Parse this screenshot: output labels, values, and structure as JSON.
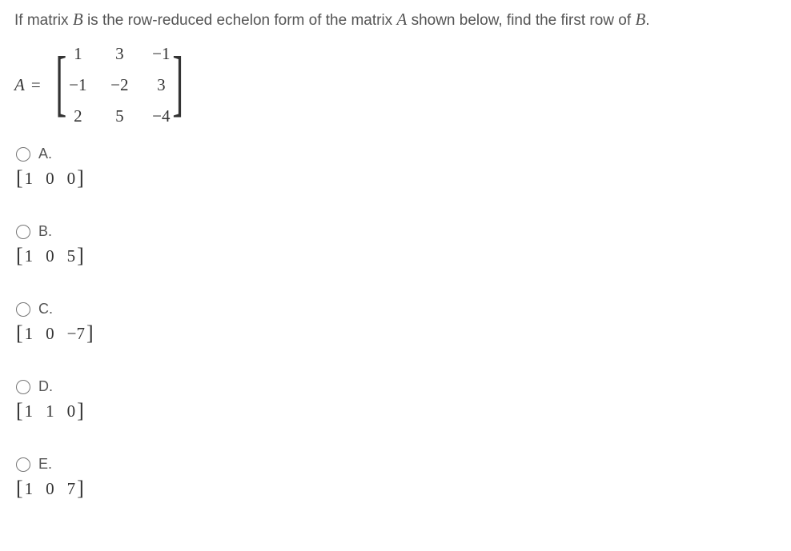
{
  "question": {
    "prefix": "If matrix ",
    "B": "B",
    "mid1": " is the row-reduced echelon form of the matrix ",
    "A": "A",
    "mid2": " shown below, find the first row of ",
    "B2": "B",
    "suffix": "."
  },
  "matrix": {
    "label": "A",
    "equals": "=",
    "r0c0": "1",
    "r0c1": "3",
    "r0c2": "−1",
    "r1c0": "−1",
    "r1c1": "−2",
    "r1c2": "3",
    "r2c0": "2",
    "r2c1": "5",
    "r2c2": "−4"
  },
  "options": {
    "a": {
      "letter": "A.",
      "v0": "1",
      "v1": "0",
      "v2": "0"
    },
    "b": {
      "letter": "B.",
      "v0": "1",
      "v1": "0",
      "v2": "5"
    },
    "c": {
      "letter": "C.",
      "v0": "1",
      "v1": "0",
      "v2": "−7"
    },
    "d": {
      "letter": "D.",
      "v0": "1",
      "v1": "1",
      "v2": "0"
    },
    "e": {
      "letter": "E.",
      "v0": "1",
      "v1": "0",
      "v2": "7"
    }
  },
  "brackets": {
    "left": "[",
    "right": "]"
  }
}
